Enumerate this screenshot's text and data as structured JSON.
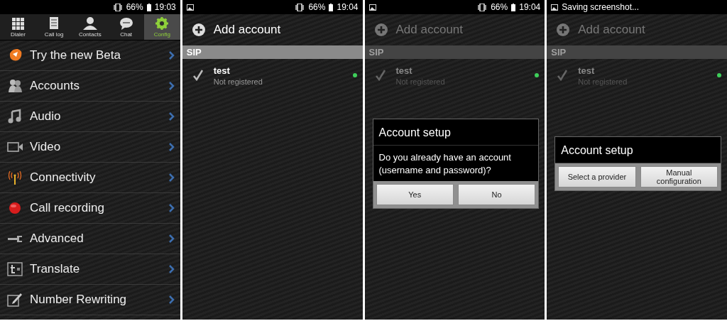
{
  "screens": [
    {
      "kind": "config",
      "status": {
        "kind": "clock",
        "battery": "66%",
        "time": "19:03"
      },
      "tabs": [
        {
          "label": "Dialer",
          "selected": false
        },
        {
          "label": "Call log",
          "selected": false
        },
        {
          "label": "Contacts",
          "selected": false
        },
        {
          "label": "Chat",
          "selected": false
        },
        {
          "label": "Config",
          "selected": true
        }
      ],
      "menu": [
        "Try the new Beta",
        "Accounts",
        "Audio",
        "Video",
        "Connectivity",
        "Call recording",
        "Advanced",
        "Translate",
        "Number Rewriting"
      ]
    },
    {
      "kind": "accounts",
      "dimmed": false,
      "status": {
        "kind": "clock",
        "battery": "66%",
        "time": "19:04"
      },
      "add_label": "Add account",
      "section": "SIP",
      "accounts": [
        {
          "name": "test",
          "status": "Not registered",
          "checked": true,
          "color": "#3ecf5a"
        }
      ]
    },
    {
      "kind": "accounts",
      "dimmed": true,
      "status": {
        "kind": "clock",
        "battery": "66%",
        "time": "19:04"
      },
      "add_label": "Add account",
      "section": "SIP",
      "accounts": [
        {
          "name": "test",
          "status": "Not registered",
          "checked": true,
          "color": "#3ecf5a"
        }
      ],
      "dialog": {
        "title": "Account setup",
        "message": "Do you already have an account (username and password)?",
        "buttons": [
          "Yes",
          "No"
        ]
      }
    },
    {
      "kind": "accounts",
      "dimmed": true,
      "status": {
        "kind": "notice",
        "text": "Saving screenshot..."
      },
      "add_label": "Add account",
      "section": "SIP",
      "accounts": [
        {
          "name": "test",
          "status": "Not registered",
          "checked": true,
          "color": "#3ecf5a"
        }
      ],
      "dialog": {
        "title": "Account setup",
        "buttons": [
          "Select a provider",
          "Manual configuration"
        ]
      }
    }
  ]
}
